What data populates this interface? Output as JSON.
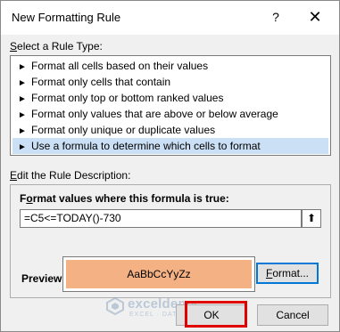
{
  "window": {
    "title": "New Formatting Rule",
    "help": "?",
    "close": "✕"
  },
  "rule_type": {
    "label_prefix": "",
    "label_hotkey": "S",
    "label_rest": "elect a Rule Type:",
    "items": [
      "Format all cells based on their values",
      "Format only cells that contain",
      "Format only top or bottom ranked values",
      "Format only values that are above or below average",
      "Format only unique or duplicate values",
      "Use a formula to determine which cells to format"
    ],
    "selected_index": 5,
    "bullet": "►"
  },
  "description": {
    "label_prefix": "",
    "label_hotkey": "E",
    "label_rest": "dit the Rule Description:",
    "formula_label_prefix": "F",
    "formula_label_hotkey": "o",
    "formula_label_rest": "rmat values where this formula is true:",
    "formula_value": "=C5<=TODAY()-730",
    "collapse_icon": "⬆",
    "preview_label": "Preview:",
    "preview_sample": "AaBbCcYyZz",
    "preview_fill": "#f4b183",
    "format_prefix": "",
    "format_hotkey": "F",
    "format_rest": "ormat..."
  },
  "buttons": {
    "ok": "OK",
    "cancel": "Cancel"
  },
  "watermark": {
    "name": "exceldemy",
    "sub": "EXCEL · DATA · BI"
  },
  "colors": {
    "selection": "#cce0f5",
    "highlight": "#e00000",
    "focus": "#0078d7"
  }
}
